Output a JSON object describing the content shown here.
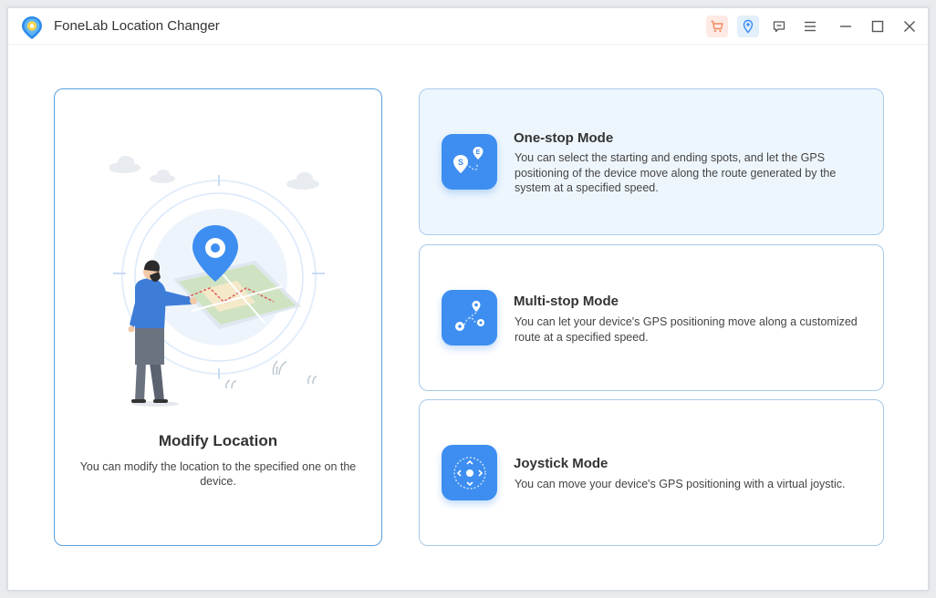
{
  "app": {
    "title": "FoneLab Location Changer",
    "logo_icon": "map-pin-logo-icon"
  },
  "titlebar": {
    "buttons": [
      {
        "icon": "cart-icon",
        "color": "#f08a5d"
      },
      {
        "icon": "location-pin-icon",
        "color": "#3d8ef0"
      },
      {
        "icon": "feedback-icon",
        "color": "#555555"
      },
      {
        "icon": "menu-icon",
        "color": "#555555"
      },
      {
        "icon": "minimize-icon",
        "color": "#555555"
      },
      {
        "icon": "maximize-icon",
        "color": "#555555"
      },
      {
        "icon": "close-icon",
        "color": "#555555"
      }
    ]
  },
  "modify": {
    "title": "Modify Location",
    "description": "You can modify the location to the specified one on the device."
  },
  "modes": {
    "one_stop": {
      "title": "One-stop Mode",
      "description": "You can select the starting and ending spots, and let the GPS positioning of the device move along the route generated by the system at a specified speed.",
      "icon_start_letter": "S",
      "icon_end_letter": "E"
    },
    "multi_stop": {
      "title": "Multi-stop Mode",
      "description": "You can let your device's GPS positioning move along a customized route at a specified speed."
    },
    "joystick": {
      "title": "Joystick Mode",
      "description": "You can move your device's GPS positioning with a virtual joystic."
    }
  },
  "colors": {
    "accent": "#3d8ef0",
    "active_card_bg": "#eef6fd",
    "card_border": "#a8c8e8",
    "selected_border": "#5c9fde"
  }
}
